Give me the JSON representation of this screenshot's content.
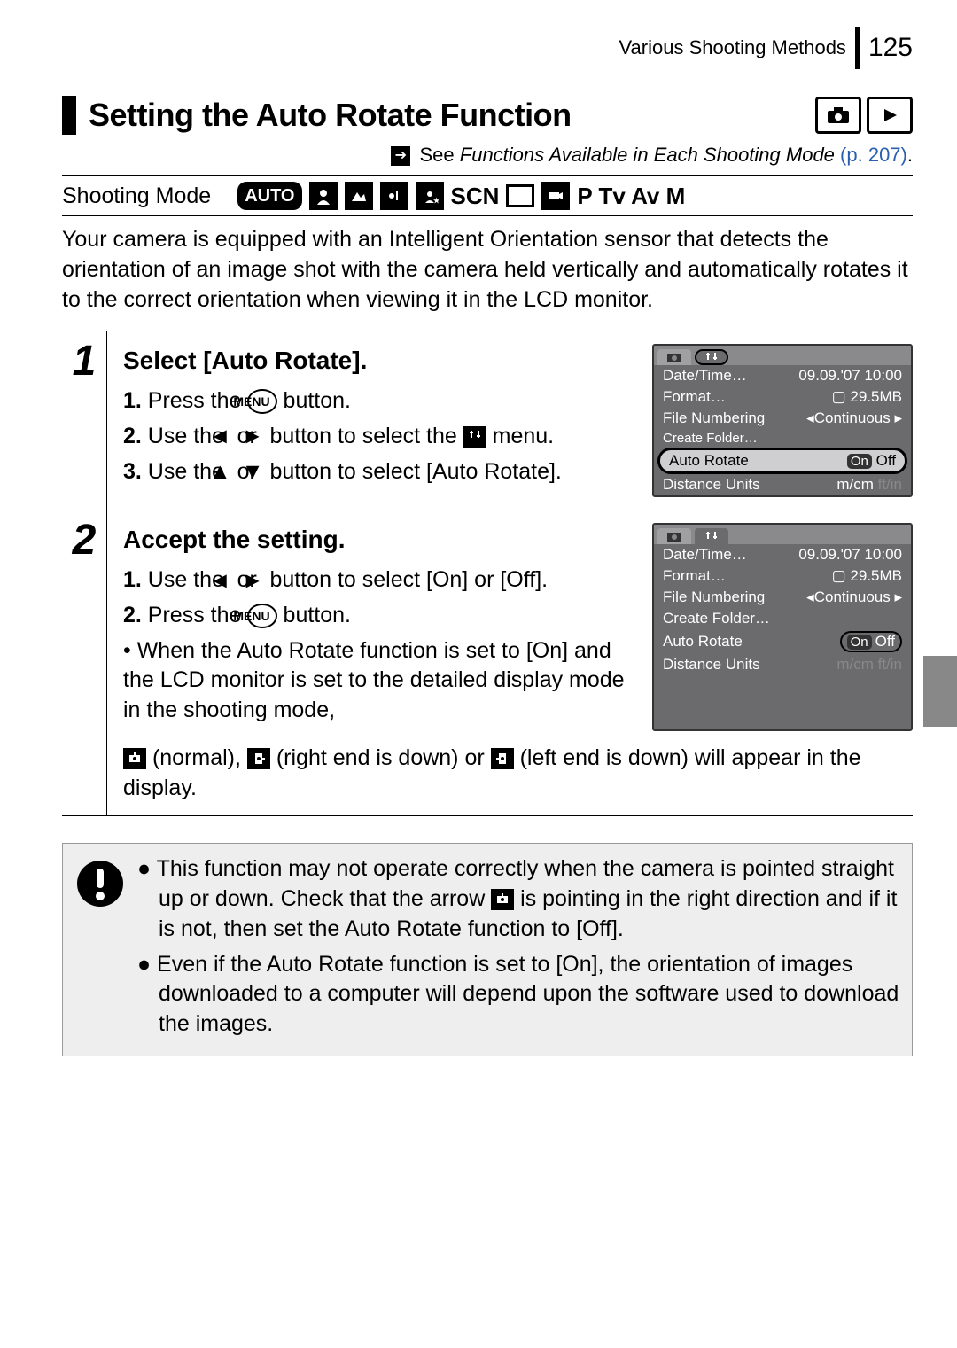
{
  "header": {
    "chapter": "Various Shooting Methods",
    "page_number": "125"
  },
  "section": {
    "title": "Setting the Auto Rotate Function"
  },
  "see_functions": {
    "prefix": "See ",
    "link_text": "Functions Available in Each Shooting Mode",
    "page_ref": "(p. 207)",
    "period": "."
  },
  "shooting_mode": {
    "label": "Shooting Mode",
    "auto_label": "AUTO",
    "scn_label": "SCN",
    "modes": "P Tv Av M"
  },
  "intro": "Your camera is equipped with an Intelligent Orientation sensor that detects the orientation of an image shot with the camera held vertically and automatically rotates it to the correct orientation when viewing it in the LCD monitor.",
  "steps": [
    {
      "num": "1",
      "heading": "Select [Auto Rotate].",
      "lines": {
        "a_num": "1.",
        "a_pre": " Press the ",
        "a_btn": "MENU",
        "a_post": " button.",
        "b_num": "2.",
        "b_pre": " Use the ",
        "b_mid": " or ",
        "b_post": " button to select the ",
        "b_tail": " menu.",
        "c_num": "3.",
        "c_pre": " Use the ",
        "c_mid": " or ",
        "c_post": " button to select [Auto Rotate]."
      }
    },
    {
      "num": "2",
      "heading": "Accept the setting.",
      "lines": {
        "a_num": "1.",
        "a_pre": " Use the ",
        "a_mid": " or ",
        "a_post": " button to select [On] or [Off].",
        "b_num": "2.",
        "b_pre": " Press the ",
        "b_btn": "MENU",
        "b_post": " button.",
        "bullet_pre": "• When the Auto Rotate function is set to [On] and the LCD monitor is set to the detailed display mode in the shooting mode, ",
        "bullet_mid1": " (normal), ",
        "bullet_mid2": " (right end is down) or ",
        "bullet_post": " (left end is down) will appear in the display."
      }
    }
  ],
  "lcd": {
    "date_time_label": "Date/Time…",
    "date_time_value": "09.09.'07 10:00",
    "format_label": "Format…",
    "format_value": "29.5MB",
    "file_num_label": "File Numbering",
    "file_num_value": "Continuous",
    "create_folder_label": "Create Folder…",
    "auto_rotate_label": "Auto Rotate",
    "on_label": "On",
    "off_label": "Off",
    "distance_label": "Distance Units",
    "distance_val1": "m/cm",
    "distance_val2": "ft/in"
  },
  "notes": {
    "b1_pre": "This function may not operate correctly when the camera is pointed straight up or down. Check that the arrow ",
    "b1_post": " is pointing in the right direction and if it is not, then set the Auto Rotate function to [Off].",
    "b2": "Even if the Auto Rotate function is set to [On], the orientation of images downloaded to a computer will depend upon the software used to download the images."
  }
}
